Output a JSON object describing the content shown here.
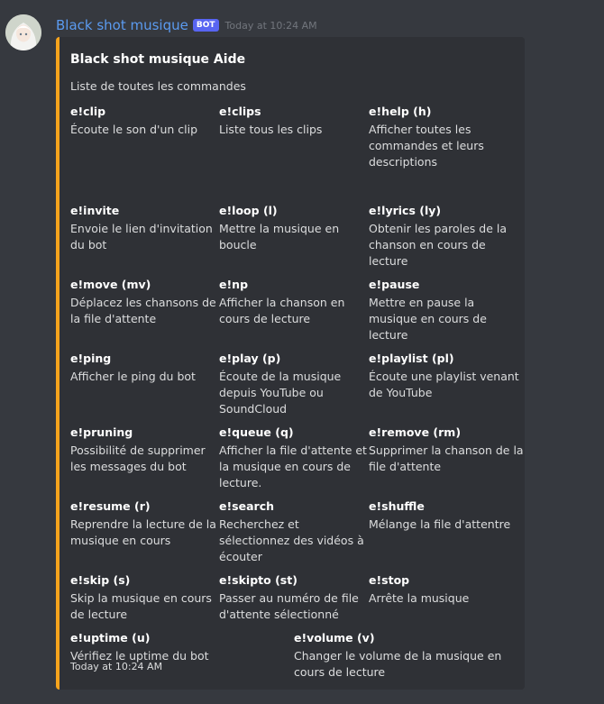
{
  "message": {
    "username": "Black shot musique",
    "bot_tag": "BOT",
    "timestamp": "Today at 10:24 AM"
  },
  "embed": {
    "accent_color": "#f7a41d",
    "title": "Black shot musique Aide",
    "description": "Liste de toutes les commandes",
    "footer": "Today at 10:24 AM",
    "fields": [
      {
        "name": "e!clip",
        "lines": [
          "Écoute le son d'un clip"
        ]
      },
      {
        "name": "e!clips",
        "lines": [
          "Liste tous les clips"
        ]
      },
      {
        "name": "e!help (h)",
        "lines": [
          "Afficher toutes les",
          "commandes et leurs",
          "descriptions"
        ]
      },
      {
        "name": "e!invite",
        "lines": [
          "Envoie le lien d'invitation",
          "du bot"
        ]
      },
      {
        "name": "e!loop (l)",
        "lines": [
          "Mettre la musique en",
          "boucle"
        ]
      },
      {
        "name": "e!lyrics (ly)",
        "lines": [
          "Obtenir les paroles de la",
          "chanson en cours de",
          "lecture"
        ]
      },
      {
        "name": "e!move (mv)",
        "lines": [
          "Déplacez les chansons de",
          "la file d'attente"
        ]
      },
      {
        "name": "e!np",
        "lines": [
          "Afficher la chanson en",
          "cours de lecture"
        ]
      },
      {
        "name": "e!pause",
        "lines": [
          "Mettre en pause la",
          "musique en cours de",
          "lecture"
        ]
      },
      {
        "name": "e!ping",
        "lines": [
          "Afficher le ping du bot"
        ]
      },
      {
        "name": "e!play (p)",
        "lines": [
          "Écoute de la musique",
          "depuis YouTube ou",
          "SoundCloud"
        ]
      },
      {
        "name": "e!playlist (pl)",
        "lines": [
          "Écoute une playlist venant",
          "de YouTube"
        ]
      },
      {
        "name": "e!pruning",
        "lines": [
          "Possibilité de supprimer",
          "les messages du bot"
        ]
      },
      {
        "name": "e!queue (q)",
        "lines": [
          "Afficher la file d'attente et",
          "la musique en cours de",
          "lecture."
        ]
      },
      {
        "name": "e!remove (rm)",
        "lines": [
          "Supprimer la chanson de la",
          "file d'attente"
        ]
      },
      {
        "name": "e!resume (r)",
        "lines": [
          "Reprendre la lecture de la",
          "musique en cours"
        ]
      },
      {
        "name": "e!search",
        "lines": [
          "Recherchez et",
          "sélectionnez des vidéos à",
          "écouter"
        ]
      },
      {
        "name": "e!shuffle",
        "lines": [
          "Mélange la file d'attentre"
        ]
      },
      {
        "name": "e!skip (s)",
        "lines": [
          "Skip la musique en cours",
          "de lecture"
        ]
      },
      {
        "name": "e!skipto (st)",
        "lines": [
          "Passer au numéro de file",
          "d'attente sélectionné"
        ]
      },
      {
        "name": "e!stop",
        "lines": [
          "Arrête la musique"
        ]
      },
      {
        "name": "e!uptime (u)",
        "lines": [
          "Vérifiez le uptime du bot"
        ]
      },
      {
        "name": "e!volume (v)",
        "lines": [
          "Changer le volume de la musique en",
          "cours de lecture"
        ]
      }
    ]
  }
}
